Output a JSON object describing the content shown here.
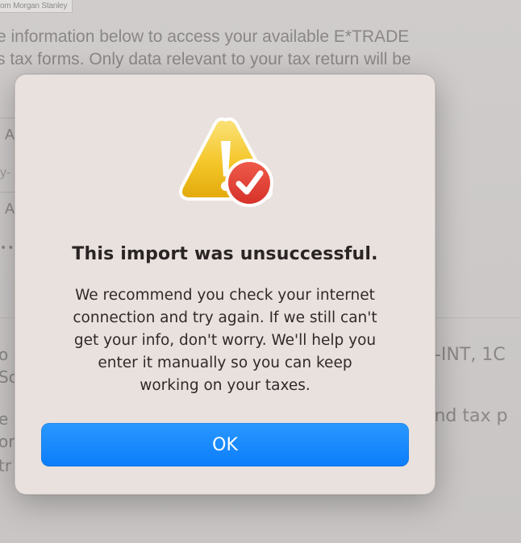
{
  "background": {
    "brand_tag": "om Morgan Stanley",
    "intro_lines": [
      "e information below to access your available E*TRADE",
      "s tax forms. Only data relevant to your tax return will be",
      "."
    ],
    "field_letters": [
      "A",
      "A"
    ],
    "field_hint": "y-",
    "password_mask": "••",
    "lower_left": [
      "o",
      "So",
      "e",
      "or",
      "tr"
    ],
    "lower_right": [
      "9-INT, 1C",
      "and tax p"
    ]
  },
  "dialog": {
    "title": "This import was unsuccessful.",
    "message_lines": [
      "We recommend you check your internet",
      "connection and try again. If we still can't",
      "get your info, don't worry. We'll help you",
      "enter it manually so you can keep",
      "working on your taxes."
    ],
    "ok_label": "OK",
    "icon": "warning-triangle-with-checkmark-badge-icon"
  },
  "colors": {
    "accent": "#0b7dfa",
    "warning": "#f2c21b",
    "badge": "#e03b2e",
    "dialog_bg": "#e9e1de"
  }
}
